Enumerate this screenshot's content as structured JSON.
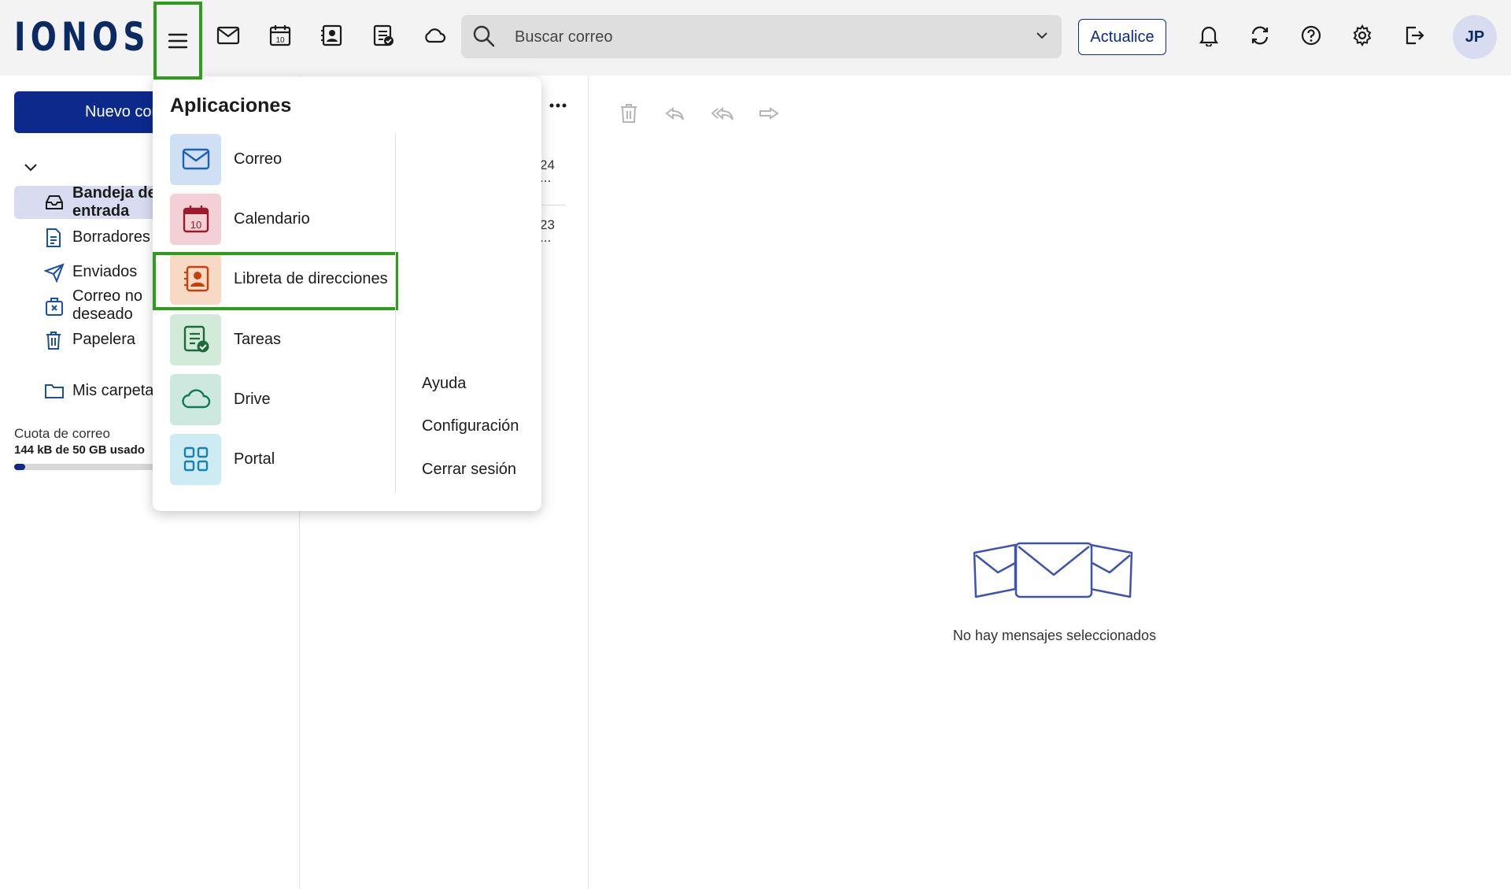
{
  "logo": "IONOS",
  "topbar": {
    "menu_icon": "hamburger-menu-icon",
    "app_icons": [
      "mail-icon",
      "calendar-icon",
      "contacts-icon",
      "tasks-icon",
      "cloud-icon"
    ],
    "search_placeholder": "Buscar correo",
    "upgrade_label": "Actualice",
    "right_icons": [
      "bell-icon",
      "sync-icon",
      "help-icon",
      "gear-icon",
      "logout-icon"
    ],
    "avatar_initials": "JP"
  },
  "sidebar": {
    "new_mail_label": "Nuevo correo",
    "folders": [
      {
        "label": "Bandeja de entrada",
        "icon": "inbox-icon",
        "active": true
      },
      {
        "label": "Borradores",
        "icon": "draft-icon"
      },
      {
        "label": "Enviados",
        "icon": "send-icon"
      },
      {
        "label": "Correo no deseado",
        "icon": "spam-icon"
      },
      {
        "label": "Papelera",
        "icon": "trash-icon"
      }
    ],
    "my_folders_label": "Mis carpetas",
    "quota_label": "Cuota de correo",
    "quota_value": "144 kB de 50 GB usado",
    "quota_fraction": 0.07
  },
  "message_list": {
    "dates": [
      "24",
      "...",
      "23",
      "..."
    ]
  },
  "reading_pane": {
    "toolbar_icons": [
      "trash-icon",
      "reply-icon",
      "reply-all-icon",
      "forward-icon"
    ],
    "empty_message": "No hay mensajes seleccionados"
  },
  "apps_menu": {
    "title": "Aplicaciones",
    "apps": [
      {
        "label": "Correo",
        "icon": "mail-icon",
        "bg": "#cfe0f5",
        "fg": "#1f5fb7"
      },
      {
        "label": "Calendario",
        "icon": "calendar-icon",
        "bg": "#f3d0d5",
        "fg": "#9b1b2b"
      },
      {
        "label": "Libreta de direcciones",
        "icon": "contacts-icon",
        "bg": "#f8d9c4",
        "fg": "#c2410c",
        "highlighted": true
      },
      {
        "label": "Tareas",
        "icon": "tasks-icon",
        "bg": "#d2ead8",
        "fg": "#1d6b3a"
      },
      {
        "label": "Drive",
        "icon": "cloud-icon",
        "bg": "#cde8de",
        "fg": "#0f7a55"
      },
      {
        "label": "Portal",
        "icon": "grid-icon",
        "bg": "#cdebf2",
        "fg": "#1b7fb0"
      }
    ],
    "links": [
      "Ayuda",
      "Configuración",
      "Cerrar sesión"
    ]
  },
  "colors": {
    "brand": "#0b2a63",
    "primary": "#0b2a8c",
    "highlight": "#2e9d1b"
  }
}
